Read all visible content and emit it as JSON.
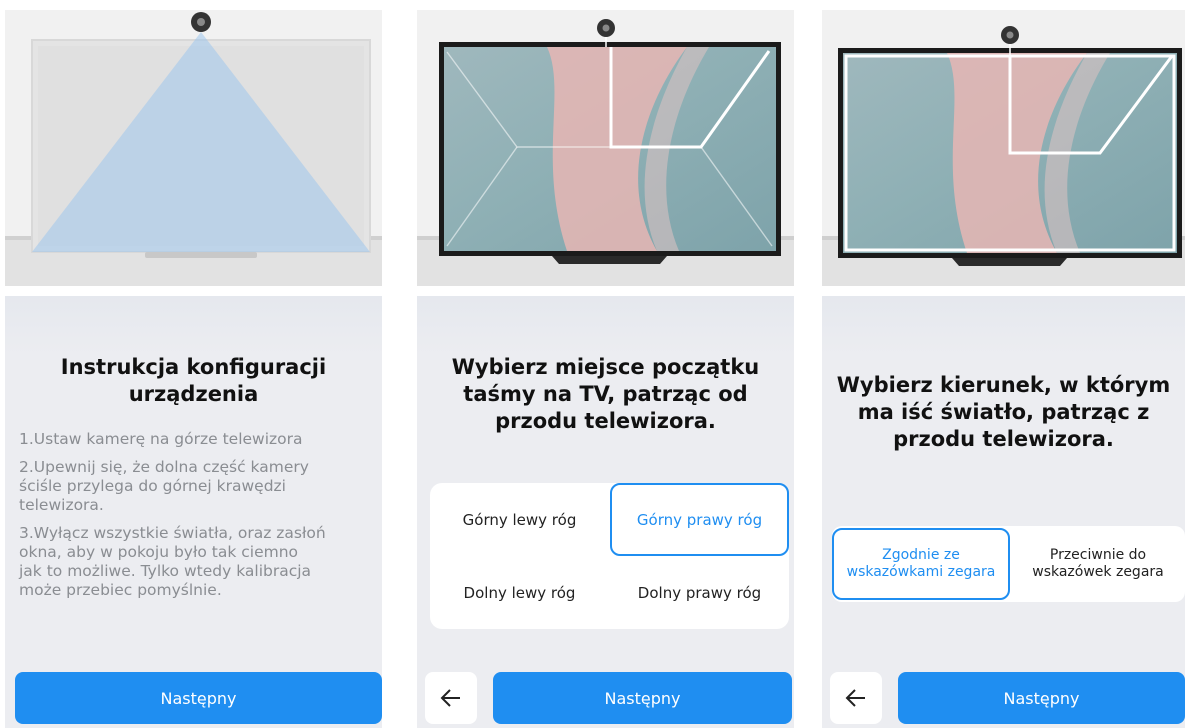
{
  "panel1": {
    "title": "Instrukcja konfiguracji\nurządzenia",
    "steps": [
      "1.Ustaw kamerę na górze telewizora",
      "2.Upewnij się, że dolna część kamery\nściśle przylega do górnej krawędzi\ntelewizora.",
      "3.Wyłącz wszystkie światła, oraz zasłoń\nokna, aby w pokoju było tak ciemno\njak to możliwe. Tylko wtedy kalibracja\nmoże przebiec pomyślnie."
    ],
    "next_label": "Następny"
  },
  "panel2": {
    "title": "Wybierz miejsce początku\ntaśmy na TV, patrząc od\nprzodu telewizora.",
    "corners": {
      "top_left": "Górny lewy róg",
      "top_right": "Górny prawy róg",
      "bottom_left": "Dolny lewy róg",
      "bottom_right": "Dolny prawy róg"
    },
    "selected": "top_right",
    "next_label": "Następny"
  },
  "panel3": {
    "title": "Wybierz kierunek, w którym\nma iść światło, patrząc z\nprzodu telewizora.",
    "clockwise": "Zgodnie ze\nwskazówkami zegara",
    "counter_clockwise": "Przeciwnie do\nwskazówek zegara",
    "selected": "clockwise",
    "next_label": "Następny"
  },
  "icons": {
    "back": "arrow-left-icon",
    "camera": "camera-icon"
  },
  "colors": {
    "accent": "#1f8ef1",
    "card_bg": "#ecedf1",
    "muted_text": "#8a8d92"
  }
}
